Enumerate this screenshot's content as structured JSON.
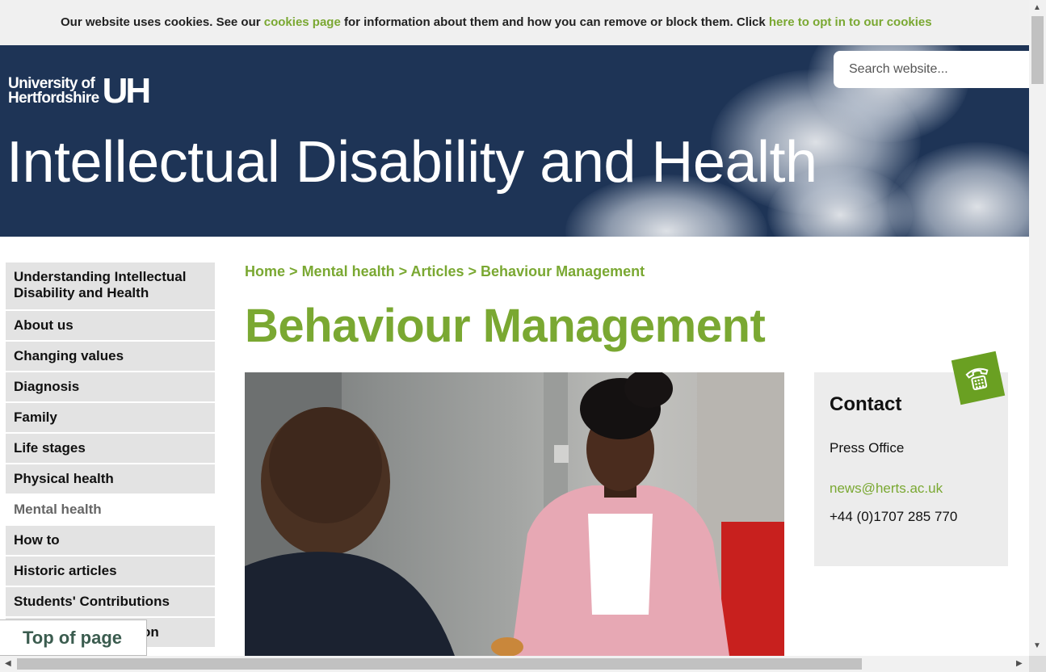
{
  "cookie_bar": {
    "text_1": "Our website uses cookies. See our ",
    "link_1": "cookies page",
    "text_2": " for information about them and how you can remove or block them. Click ",
    "link_2": "here to opt in to our cookies"
  },
  "header": {
    "logo_line1": "University of",
    "logo_line2": "Hertfordshire",
    "logo_mark": "UH",
    "site_title": "Intellectual Disability and Health",
    "search_placeholder": "Search website..."
  },
  "sidebar": {
    "items": [
      {
        "label": "Understanding Intellectual Disability and Health"
      },
      {
        "label": "About us"
      },
      {
        "label": "Changing values"
      },
      {
        "label": "Diagnosis"
      },
      {
        "label": "Family"
      },
      {
        "label": "Life stages"
      },
      {
        "label": "Physical health"
      },
      {
        "label": "Mental health"
      },
      {
        "label": "How to"
      },
      {
        "label": "Historic articles"
      },
      {
        "label": "Students' Contributions"
      },
      {
        "label": "on"
      }
    ]
  },
  "breadcrumb": {
    "items": [
      "Home",
      "Mental health",
      "Articles",
      "Behaviour Management"
    ],
    "separator": ">"
  },
  "page_title": "Behaviour Management",
  "contact": {
    "heading": "Contact",
    "office": "Press Office",
    "email": "news@herts.ac.uk",
    "phone": "+44 (0)1707 285 770",
    "icon": "telephone-icon"
  },
  "top_of_page": "Top of page",
  "colors": {
    "accent_green": "#7aa832",
    "header_navy": "#1e3456",
    "nav_gray": "#e3e3e3"
  }
}
